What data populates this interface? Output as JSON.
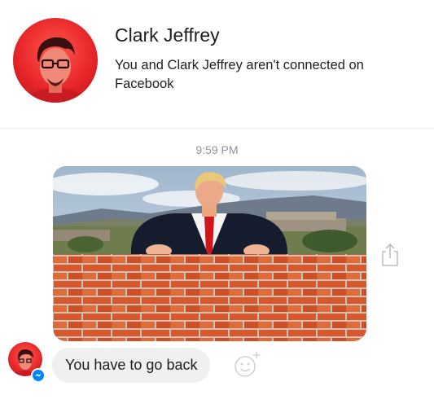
{
  "header": {
    "contact_name": "Clark Jeffrey",
    "connection_text": "You and Clark Jeffrey aren't connected on Facebook"
  },
  "conversation": {
    "timestamp": "9:59 PM",
    "messages": [
      {
        "type": "image",
        "from": "Clark Jeffrey"
      },
      {
        "type": "text",
        "from": "Clark Jeffrey",
        "text": "You have to go back"
      }
    ]
  },
  "icons": {
    "share": "share-icon",
    "reaction": "smiley-add-reaction-icon",
    "badge": "messenger-badge-icon"
  },
  "colors": {
    "avatar_red": "#e8262a",
    "messenger_blue": "#0084ff",
    "bubble_gray": "#f1f0f0",
    "timestamp_gray": "#8d949e"
  }
}
